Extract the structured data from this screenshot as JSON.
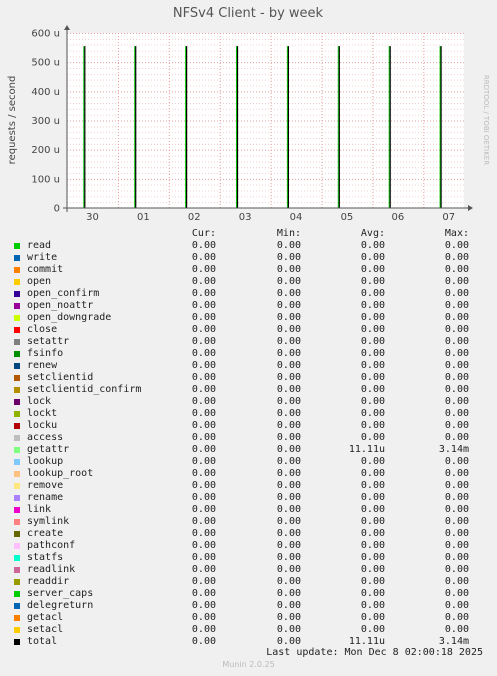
{
  "chart_data": {
    "type": "line",
    "title": "NFSv4 Client - by week",
    "ylabel": "requests / second",
    "watermark": "RRDTOOL / TOBI OETIKER",
    "ylim": [
      0,
      600
    ],
    "y_ticks": [
      0,
      100,
      200,
      300,
      400,
      500,
      600
    ],
    "y_tick_labels": [
      "0",
      "100 u",
      "200 u",
      "300 u",
      "400 u",
      "500 u",
      "600 u"
    ],
    "x_tick_labels": [
      "30",
      "01",
      "02",
      "03",
      "04",
      "05",
      "06",
      "07"
    ],
    "xlim": [
      0,
      7.8
    ],
    "x_tick_positions": [
      0.5,
      1.5,
      2.5,
      3.5,
      4.5,
      5.5,
      6.5,
      7.5
    ],
    "series": [
      {
        "name": "total",
        "color": "#000000",
        "spikes": [
          0.35,
          1.35,
          2.35,
          3.35,
          4.35,
          5.35,
          6.35,
          7.35
        ],
        "peak": 555
      }
    ],
    "grid": true
  },
  "legend": {
    "headers": {
      "cur": "Cur:",
      "min": "Min:",
      "avg": "Avg:",
      "max": "Max:"
    },
    "rows": [
      {
        "name": "read",
        "color": "#00cc00",
        "cur": "0.00",
        "min": "0.00",
        "avg": "0.00",
        "max": "0.00"
      },
      {
        "name": "write",
        "color": "#0066b3",
        "cur": "0.00",
        "min": "0.00",
        "avg": "0.00",
        "max": "0.00"
      },
      {
        "name": "commit",
        "color": "#ff8000",
        "cur": "0.00",
        "min": "0.00",
        "avg": "0.00",
        "max": "0.00"
      },
      {
        "name": "open",
        "color": "#ffcc00",
        "cur": "0.00",
        "min": "0.00",
        "avg": "0.00",
        "max": "0.00"
      },
      {
        "name": "open_confirm",
        "color": "#330099",
        "cur": "0.00",
        "min": "0.00",
        "avg": "0.00",
        "max": "0.00"
      },
      {
        "name": "open_noattr",
        "color": "#990099",
        "cur": "0.00",
        "min": "0.00",
        "avg": "0.00",
        "max": "0.00"
      },
      {
        "name": "open_downgrade",
        "color": "#ccff00",
        "cur": "0.00",
        "min": "0.00",
        "avg": "0.00",
        "max": "0.00"
      },
      {
        "name": "close",
        "color": "#ff0000",
        "cur": "0.00",
        "min": "0.00",
        "avg": "0.00",
        "max": "0.00"
      },
      {
        "name": "setattr",
        "color": "#808080",
        "cur": "0.00",
        "min": "0.00",
        "avg": "0.00",
        "max": "0.00"
      },
      {
        "name": "fsinfo",
        "color": "#008f00",
        "cur": "0.00",
        "min": "0.00",
        "avg": "0.00",
        "max": "0.00"
      },
      {
        "name": "renew",
        "color": "#00487d",
        "cur": "0.00",
        "min": "0.00",
        "avg": "0.00",
        "max": "0.00"
      },
      {
        "name": "setclientid",
        "color": "#b35a00",
        "cur": "0.00",
        "min": "0.00",
        "avg": "0.00",
        "max": "0.00"
      },
      {
        "name": "setclientid_confirm",
        "color": "#b38f00",
        "cur": "0.00",
        "min": "0.00",
        "avg": "0.00",
        "max": "0.00"
      },
      {
        "name": "lock",
        "color": "#6b006b",
        "cur": "0.00",
        "min": "0.00",
        "avg": "0.00",
        "max": "0.00"
      },
      {
        "name": "lockt",
        "color": "#8fb300",
        "cur": "0.00",
        "min": "0.00",
        "avg": "0.00",
        "max": "0.00"
      },
      {
        "name": "locku",
        "color": "#b30000",
        "cur": "0.00",
        "min": "0.00",
        "avg": "0.00",
        "max": "0.00"
      },
      {
        "name": "access",
        "color": "#bebebe",
        "cur": "0.00",
        "min": "0.00",
        "avg": "0.00",
        "max": "0.00"
      },
      {
        "name": "getattr",
        "color": "#80ff80",
        "cur": "0.00",
        "min": "0.00",
        "avg": "11.11u",
        "max": "3.14m"
      },
      {
        "name": "lookup",
        "color": "#80c9ff",
        "cur": "0.00",
        "min": "0.00",
        "avg": "0.00",
        "max": "0.00"
      },
      {
        "name": "lookup_root",
        "color": "#ffc080",
        "cur": "0.00",
        "min": "0.00",
        "avg": "0.00",
        "max": "0.00"
      },
      {
        "name": "remove",
        "color": "#ffe680",
        "cur": "0.00",
        "min": "0.00",
        "avg": "0.00",
        "max": "0.00"
      },
      {
        "name": "rename",
        "color": "#aa80ff",
        "cur": "0.00",
        "min": "0.00",
        "avg": "0.00",
        "max": "0.00"
      },
      {
        "name": "link",
        "color": "#ee00cc",
        "cur": "0.00",
        "min": "0.00",
        "avg": "0.00",
        "max": "0.00"
      },
      {
        "name": "symlink",
        "color": "#ff8080",
        "cur": "0.00",
        "min": "0.00",
        "avg": "0.00",
        "max": "0.00"
      },
      {
        "name": "create",
        "color": "#666600",
        "cur": "0.00",
        "min": "0.00",
        "avg": "0.00",
        "max": "0.00"
      },
      {
        "name": "pathconf",
        "color": "#ffbfff",
        "cur": "0.00",
        "min": "0.00",
        "avg": "0.00",
        "max": "0.00"
      },
      {
        "name": "statfs",
        "color": "#00ffcc",
        "cur": "0.00",
        "min": "0.00",
        "avg": "0.00",
        "max": "0.00"
      },
      {
        "name": "readlink",
        "color": "#cc6699",
        "cur": "0.00",
        "min": "0.00",
        "avg": "0.00",
        "max": "0.00"
      },
      {
        "name": "readdir",
        "color": "#999900",
        "cur": "0.00",
        "min": "0.00",
        "avg": "0.00",
        "max": "0.00"
      },
      {
        "name": "server_caps",
        "color": "#00cc00",
        "cur": "0.00",
        "min": "0.00",
        "avg": "0.00",
        "max": "0.00"
      },
      {
        "name": "delegreturn",
        "color": "#0066b3",
        "cur": "0.00",
        "min": "0.00",
        "avg": "0.00",
        "max": "0.00"
      },
      {
        "name": "getacl",
        "color": "#ff8000",
        "cur": "0.00",
        "min": "0.00",
        "avg": "0.00",
        "max": "0.00"
      },
      {
        "name": "setacl",
        "color": "#ffcc00",
        "cur": "0.00",
        "min": "0.00",
        "avg": "0.00",
        "max": "0.00"
      },
      {
        "name": "total",
        "color": "#000000",
        "cur": "0.00",
        "min": "0.00",
        "avg": "11.11u",
        "max": "3.14m"
      }
    ]
  },
  "last_update": "Last update:  Mon Dec  8 02:00:18 2025",
  "footer": "Munin 2.0.25"
}
